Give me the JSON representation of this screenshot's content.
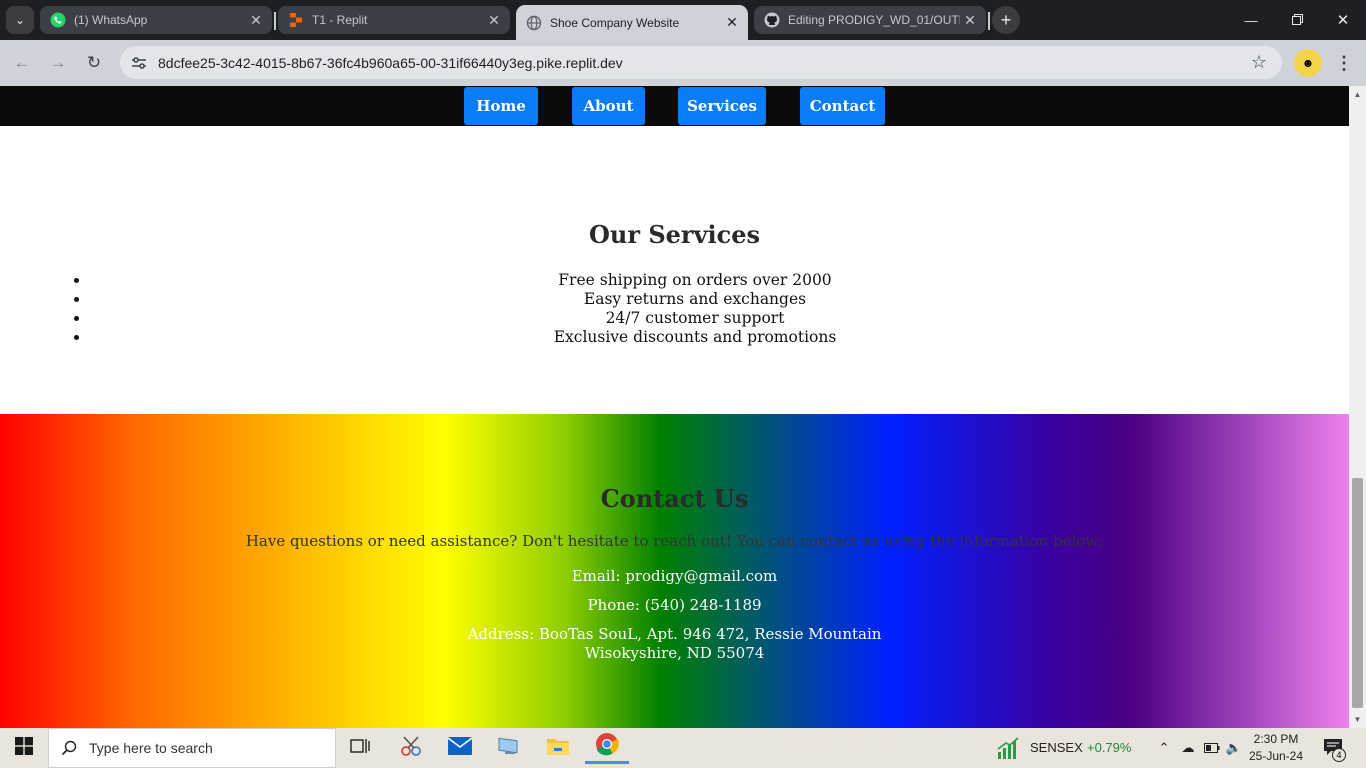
{
  "browser": {
    "tabs": [
      {
        "title": "(1) WhatsApp",
        "icon": "whatsapp-icon",
        "active": false
      },
      {
        "title": "T1 - Replit",
        "icon": "replit-icon",
        "active": false
      },
      {
        "title": "Shoe Company Website",
        "icon": "globe-icon",
        "active": true
      },
      {
        "title": "Editing PRODIGY_WD_01/OUTP",
        "icon": "github-icon",
        "active": false
      }
    ],
    "new_tab_label": "+",
    "url": "8dcfee25-3c42-4015-8b67-36fc4b960a65-00-31if66440y3eg.pike.replit.dev"
  },
  "page": {
    "nav": [
      "Home",
      "About",
      "Services",
      "Contact"
    ],
    "nav_color": "#0a7cf6",
    "services": {
      "title": "Our Services",
      "items": [
        "Free shipping on orders over 2000",
        "Easy returns and exchanges",
        "24/7 customer support",
        "Exclusive discounts and promotions"
      ]
    },
    "contact": {
      "title": "Contact Us",
      "intro": "Have questions or need assistance? Don't hesitate to reach out! You can contact us using the information below:",
      "email": "Email: prodigy@gmail.com",
      "phone": "Phone: (540) 248-1189",
      "address_line1": "Address: BooTas SouL, Apt. 946 472, Ressie Mountain",
      "address_line2": "Wisokyshire, ND 55074"
    }
  },
  "taskbar": {
    "search_placeholder": "Type here to search",
    "sensex_label": "SENSEX",
    "sensex_change": "+0.79%",
    "time": "2:30 PM",
    "date": "25-Jun-24",
    "notification_count": "4"
  }
}
